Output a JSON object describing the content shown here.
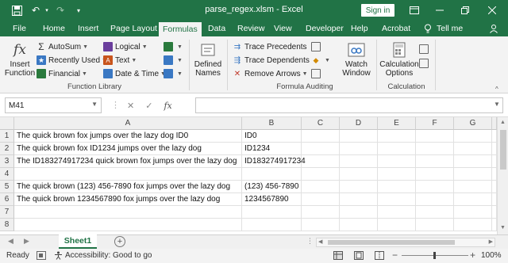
{
  "titlebar": {
    "title": "parse_regex.xlsm  -  Excel",
    "signin": "Sign in",
    "icons": [
      "save-icon",
      "undo-icon",
      "redo-icon",
      "customize-icon",
      "ribbon-display-icon",
      "minimize-icon",
      "restore-icon",
      "close-icon"
    ]
  },
  "menu": {
    "tabs": [
      "File",
      "Home",
      "Insert",
      "Page Layout",
      "Formulas",
      "Data",
      "Review",
      "View",
      "Developer",
      "Help",
      "Acrobat"
    ],
    "active": "Formulas",
    "tell_me": "Tell me"
  },
  "ribbon": {
    "insert_function": "Insert\nFunction",
    "autosum": "AutoSum",
    "recently_used": "Recently Used",
    "financial": "Financial",
    "logical": "Logical",
    "text": "Text",
    "date_time": "Date & Time",
    "defined_names": "Defined\nNames",
    "trace_precedents": "Trace Precedents",
    "trace_dependents": "Trace Dependents",
    "remove_arrows": "Remove Arrows",
    "watch_window": "Watch\nWindow",
    "calculation_options": "Calculation\nOptions",
    "groups": {
      "function_library": "Function Library",
      "formula_auditing": "Formula Auditing",
      "calculation": "Calculation"
    }
  },
  "formula_bar": {
    "name_box": "M41",
    "formula": "",
    "fx": "fx"
  },
  "grid": {
    "columns": [
      "A",
      "B",
      "C",
      "D",
      "E",
      "F",
      "G"
    ],
    "rows": [
      {
        "n": "1",
        "a": "The quick brown fox jumps over the lazy dog ID0",
        "b": "ID0"
      },
      {
        "n": "2",
        "a": "The quick brown fox ID1234 jumps over the lazy dog",
        "b": "ID1234"
      },
      {
        "n": "3",
        "a": "The ID183274917234 quick brown fox jumps over the lazy dog",
        "b": "ID183274917234"
      },
      {
        "n": "4",
        "a": "",
        "b": ""
      },
      {
        "n": "5",
        "a": "The quick brown (123) 456-7890 fox jumps over the lazy dog",
        "b": "(123) 456-7890"
      },
      {
        "n": "6",
        "a": "The quick brown 1234567890 fox jumps over the lazy dog",
        "b": "1234567890"
      },
      {
        "n": "7",
        "a": "",
        "b": ""
      },
      {
        "n": "8",
        "a": "",
        "b": ""
      }
    ]
  },
  "sheets": {
    "active": "Sheet1"
  },
  "status": {
    "ready": "Ready",
    "accessibility": "Accessibility: Good to go",
    "zoom": "100%"
  },
  "colors": {
    "accent": "#217346"
  }
}
